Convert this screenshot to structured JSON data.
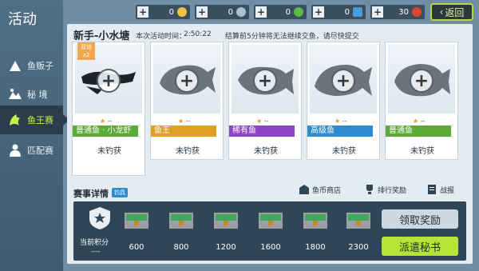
{
  "app": {
    "title": "活动"
  },
  "sidebar": {
    "items": [
      {
        "label": "鱼贩子"
      },
      {
        "label": "秘 境"
      },
      {
        "label": "鱼王赛"
      },
      {
        "label": "匹配赛"
      }
    ]
  },
  "currencies": [
    {
      "value": "0",
      "color": "#f0c23b"
    },
    {
      "value": "0",
      "color": "#a8c2cf"
    },
    {
      "value": "0",
      "color": "#5eb84a"
    },
    {
      "value": "0",
      "color": "#4a9bd6"
    },
    {
      "value": "30",
      "color": "#e2432f"
    }
  ],
  "header": {
    "back_label": "返回"
  },
  "panel": {
    "lake_name": "新手-小水塘",
    "activity_time_label": "本次活动时间：",
    "activity_time": "2:50:22",
    "settle_note": "结算前5分钟将无法继续交鱼，请尽快提交",
    "badge_text": "双倍",
    "badge_mult": "x2"
  },
  "cards": [
    {
      "rating": "--",
      "label": "普通鱼 · 小龙虾",
      "label_color": "#5eaa38",
      "status": "未钓获"
    },
    {
      "rating": "--",
      "label": "鱼王",
      "label_color": "#e0a024",
      "status": "未钓获"
    },
    {
      "rating": "--",
      "label": "稀有鱼",
      "label_color": "#8b44c3",
      "status": "未钓获"
    },
    {
      "rating": "--",
      "label": "高级鱼",
      "label_color": "#2f8bd1",
      "status": "未钓获"
    },
    {
      "rating": "--",
      "label": "普通鱼",
      "label_color": "#5eaa38",
      "status": "未钓获"
    }
  ],
  "details": {
    "title": "赛事详情",
    "fish_tag": "钓具",
    "links": [
      {
        "label": "鱼币商店"
      },
      {
        "label": "排行奖励"
      },
      {
        "label": "战报"
      }
    ],
    "score_label": "当前积分",
    "score_value": "----",
    "milestones": [
      "600",
      "800",
      "1200",
      "1600",
      "1800",
      "2300"
    ],
    "claim_label": "领取奖励",
    "dispatch_label": "派遣秘书"
  }
}
